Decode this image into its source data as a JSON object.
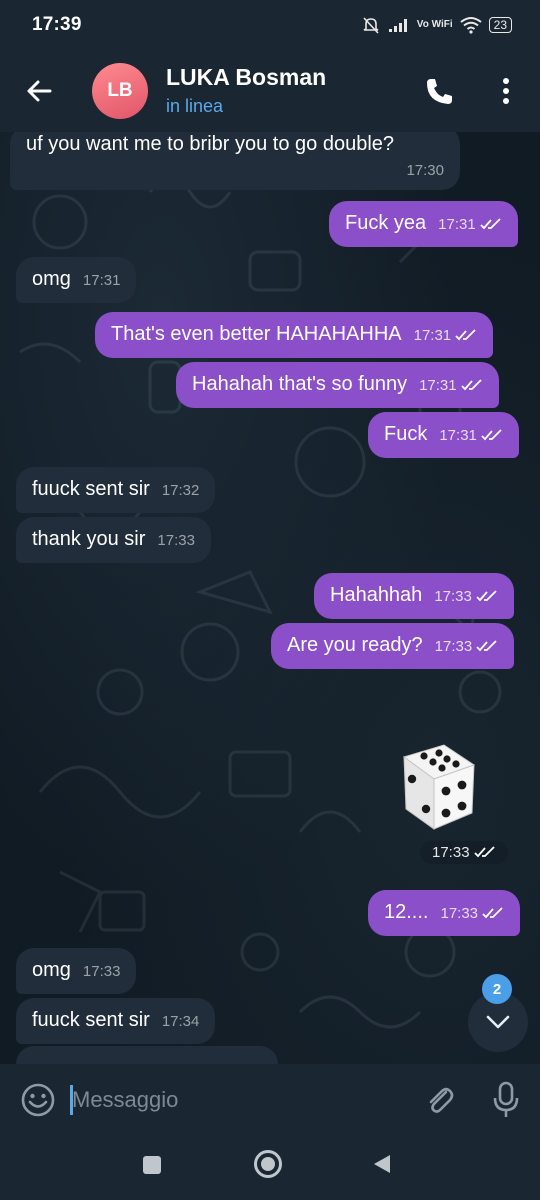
{
  "status_bar": {
    "time": "17:39",
    "network": "Vo WiFi",
    "battery": "23",
    "icons": [
      "mute-bell-icon",
      "signal-icon",
      "vowifi-icon",
      "wifi-icon",
      "battery-icon"
    ]
  },
  "header": {
    "avatar_initials": "LB",
    "contact_name": "LUKA Bosman",
    "contact_status": "in linea",
    "accent_color": "#5ca8e8",
    "avatar_color": "#e0566a"
  },
  "messages": [
    {
      "dir": "in",
      "text": "uf you want me to bribr you to go double?",
      "time": "17:30"
    },
    {
      "dir": "out",
      "text": "Fuck yea",
      "time": "17:31"
    },
    {
      "dir": "in",
      "text": "omg",
      "time": "17:31"
    },
    {
      "dir": "out",
      "text": "That's even better HAHAHAHHA",
      "time": "17:31"
    },
    {
      "dir": "out",
      "text": "Hahahah that's so funny",
      "time": "17:31"
    },
    {
      "dir": "out",
      "text": "Fuck",
      "time": "17:31"
    },
    {
      "dir": "in",
      "text": "fuuck sent sir",
      "time": "17:32"
    },
    {
      "dir": "in",
      "text": "thank you sir",
      "time": "17:33"
    },
    {
      "dir": "out",
      "text": "Hahahhah",
      "time": "17:33"
    },
    {
      "dir": "out",
      "text": "Are you ready?",
      "time": "17:33"
    },
    {
      "dir": "out",
      "type": "dice",
      "value": 6,
      "time": "17:33"
    },
    {
      "dir": "out",
      "text": "12....",
      "time": "17:33"
    },
    {
      "dir": "in",
      "text": "omg",
      "time": "17:33"
    },
    {
      "dir": "in",
      "text": "fuuck sent sir",
      "time": "17:34"
    }
  ],
  "colors": {
    "outgoing_bubble": "#8b4fc9",
    "incoming_bubble": "#212d3a",
    "chat_background": "#111b24"
  },
  "scroll_down": {
    "unread_count": "2"
  },
  "composer": {
    "placeholder": "Messaggio"
  },
  "nav_bar": {
    "items": [
      "recents-icon",
      "home-icon",
      "back-icon"
    ]
  }
}
